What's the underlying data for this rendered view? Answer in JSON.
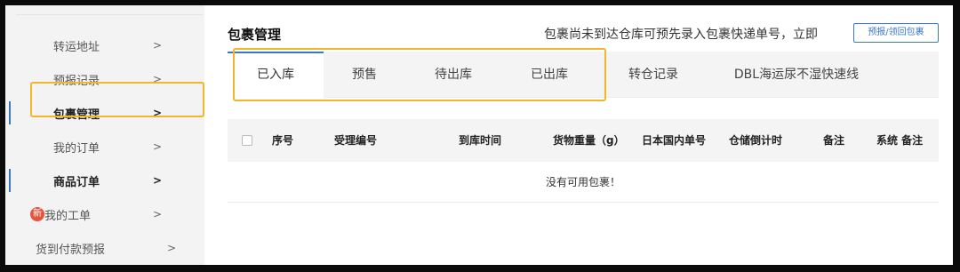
{
  "sidebar": {
    "items": [
      {
        "label": "转运地址",
        "arrow": ">"
      },
      {
        "label": "预报记录",
        "arrow": ">"
      },
      {
        "label": "包裹管理",
        "arrow": ">"
      },
      {
        "label": "我的订单",
        "arrow": ">"
      },
      {
        "label": "商品订单",
        "arrow": ">"
      },
      {
        "label": "我的工单",
        "arrow": ">",
        "badge": "新"
      },
      {
        "label": "货到付款预报",
        "arrow": ">"
      }
    ]
  },
  "main": {
    "title": "包裹管理",
    "notice": "包裹尚未到达仓库可预先录入包裹快递单号，立即",
    "notice_button": "预报/领回包裹",
    "tabs": [
      "已入库",
      "预售",
      "待出库",
      "已出库",
      "转仓记录",
      "DBL海运尿不湿快速线"
    ],
    "active_tab": "已入库",
    "table": {
      "headers": [
        "序号",
        "受理编号",
        "到库时间",
        "货物重量（g）",
        "日本国内单号",
        "仓储倒计时",
        "备注",
        "系统 备注"
      ],
      "empty_text": "没有可用包裹！"
    }
  },
  "colors": {
    "accent": "#3a78c2",
    "highlight": "#f3b62b",
    "badge": "#e4543e"
  }
}
